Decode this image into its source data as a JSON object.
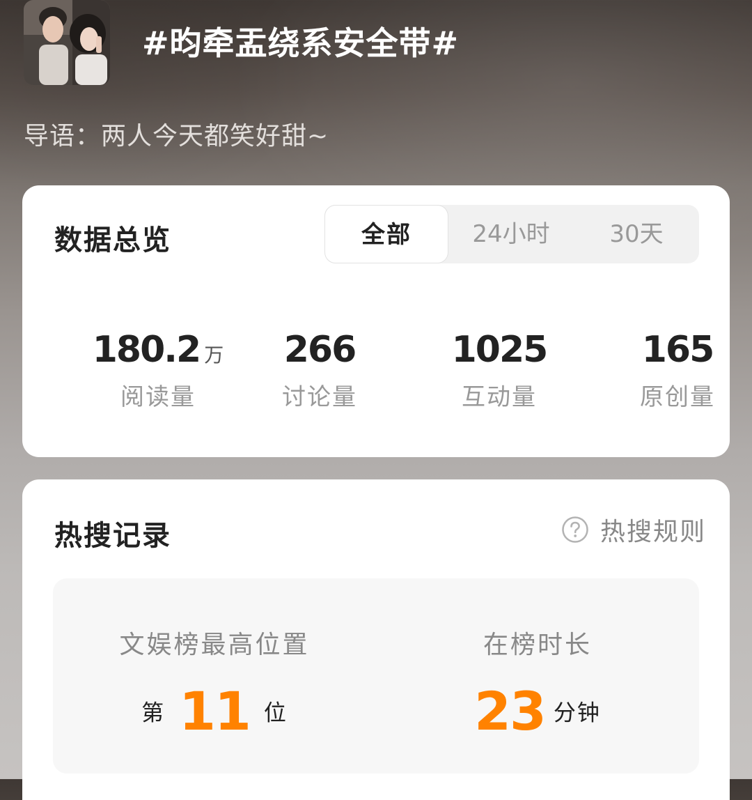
{
  "header": {
    "topic_title": "#昀牵盂绕系安全带#",
    "intro": "导语：两人今天都笑好甜~"
  },
  "overview": {
    "title": "数据总览",
    "tabs": [
      {
        "label": "全部",
        "active": true
      },
      {
        "label": "24小时",
        "active": false
      },
      {
        "label": "30天",
        "active": false
      }
    ],
    "stats": [
      {
        "value": "180.2",
        "unit": "万",
        "label": "阅读量"
      },
      {
        "value": "266",
        "unit": "",
        "label": "讨论量"
      },
      {
        "value": "1025",
        "unit": "",
        "label": "互动量"
      },
      {
        "value": "165",
        "unit": "",
        "label": "原创量"
      }
    ]
  },
  "hot_search": {
    "title": "热搜记录",
    "rules_label": "热搜规则",
    "rules_icon": "question-circle-icon",
    "best_rank": {
      "label": "文娱榜最高位置",
      "prefix": "第",
      "value": "11",
      "suffix": "位"
    },
    "duration": {
      "label": "在榜时长",
      "value": "23",
      "suffix": "分钟"
    },
    "accent_color": "#ff8200"
  }
}
